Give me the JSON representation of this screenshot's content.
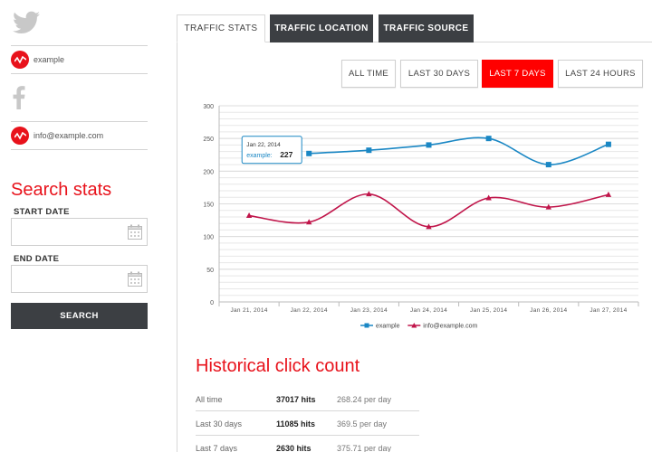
{
  "sidebar": {
    "accounts": [
      {
        "network": "twitter-icon",
        "handle": "example"
      },
      {
        "network": "facebook-icon",
        "handle": "info@example.com"
      }
    ],
    "title": "Search stats",
    "start_label": "START DATE",
    "end_label": "END DATE",
    "start_value": "",
    "end_value": "",
    "search_label": "SEARCH"
  },
  "tabs": [
    "TRAFFIC STATS",
    "TRAFFIC LOCATION",
    "TRAFFIC SOURCE"
  ],
  "ranges": [
    "ALL TIME",
    "LAST 30 DAYS",
    "LAST 7 DAYS",
    "LAST 24 HOURS"
  ],
  "active_range": "LAST 7 DAYS",
  "colors": {
    "accent": "#e8121b",
    "example_series": "#1a87c4",
    "info_series": "#c0154a",
    "dark": "#3c3f43"
  },
  "chart_data": {
    "type": "line",
    "categories": [
      "Jan 21, 2014",
      "Jan 22, 2014",
      "Jan 23, 2014",
      "Jan 24, 2014",
      "Jan 25, 2014",
      "Jan 26, 2014",
      "Jan 27, 2014"
    ],
    "ylim": [
      0,
      300
    ],
    "yticks": [
      0,
      50,
      100,
      150,
      200,
      250,
      300
    ],
    "grid": true,
    "legend": "bottom",
    "series": [
      {
        "name": "example",
        "values": [
          null,
          227,
          232,
          240,
          250,
          210,
          241
        ]
      },
      {
        "name": "info@example.com",
        "values": [
          132,
          122,
          165,
          115,
          159,
          145,
          164
        ]
      }
    ],
    "tooltip": {
      "date": "Jan 22, 2014",
      "series": "example",
      "value": "227"
    }
  },
  "history": {
    "title": "Historical click count",
    "rows": [
      {
        "period": "All time",
        "hits": "37017 hits",
        "per_day": "268.24 per day"
      },
      {
        "period": "Last 30 days",
        "hits": "11085 hits",
        "per_day": "369.5 per day"
      },
      {
        "period": "Last 7 days",
        "hits": "2630 hits",
        "per_day": "375.71 per day"
      }
    ]
  }
}
